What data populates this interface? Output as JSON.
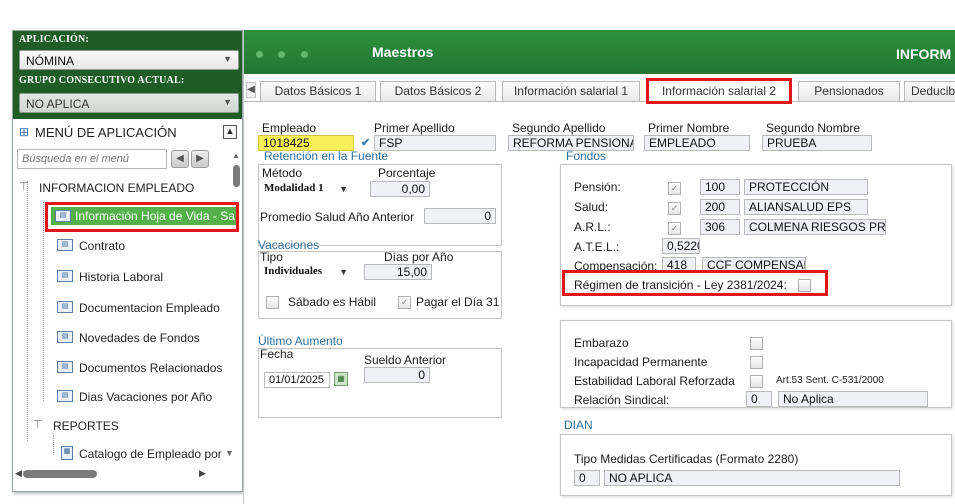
{
  "sidebar": {
    "app_label": "APLICACIÓN:",
    "app_value": "NÓMINA",
    "group_label": "GRUPO CONSECUTIVO ACTUAL:",
    "group_value": "NO APLICA",
    "menu_title": "MENÚ DE APLICACIÓN",
    "search_placeholder": "Búsqueda en el menú",
    "section": "INFORMACION EMPLEADO",
    "items": [
      {
        "label": "Información Hoja de Vida - Sa"
      },
      {
        "label": "Contrato"
      },
      {
        "label": "Historia Laboral"
      },
      {
        "label": "Documentacion Empleado"
      },
      {
        "label": "Novedades de Fondos"
      },
      {
        "label": "Documentos Relacionados"
      },
      {
        "label": "Dias Vacaciones por Año"
      }
    ],
    "reports": "REPORTES",
    "report_item": "Catalogo de Empleado por"
  },
  "header": {
    "title": "Maestros",
    "right_title": "INFORM"
  },
  "tabs": [
    {
      "label": "Datos Básicos 1"
    },
    {
      "label": "Datos Básicos 2"
    },
    {
      "label": "Información salarial 1"
    },
    {
      "label": "Información salarial 2"
    },
    {
      "label": "Pensionados"
    },
    {
      "label": "Deducib"
    }
  ],
  "employee": {
    "empleado_label": "Empleado",
    "empleado_value": "1018425",
    "primer_apellido_label": "Primer Apellido",
    "primer_apellido_value": "FSP",
    "segundo_apellido_label": "Segundo Apellido",
    "segundo_apellido_value": "REFORMA PENSIONAL",
    "primer_nombre_label": "Primer Nombre",
    "primer_nombre_value": "EMPLEADO",
    "segundo_nombre_label": "Segundo Nombre",
    "segundo_nombre_value": "PRUEBA"
  },
  "retencion": {
    "title": "Retención en la Fuente",
    "metodo_label": "Método",
    "metodo_value": "Modalidad 1",
    "porcentaje_label": "Porcentaje",
    "porcentaje_value": "0,00",
    "promedio_label": "Promedio Salud Año Anterior",
    "promedio_value": "0"
  },
  "vacaciones": {
    "title": "Vacaciones",
    "tipo_label": "Tipo",
    "tipo_value": "Individuales",
    "dias_label": "Días por Año",
    "dias_value": "15,00",
    "sabado_label": "Sábado es Hábil",
    "pagar_label": "Pagar el Día 31"
  },
  "aumento": {
    "title": "Último Aumento",
    "fecha_label": "Fecha",
    "fecha_value": "01/01/2025",
    "sueldo_label": "Sueldo Anterior",
    "sueldo_value": "0"
  },
  "fondos": {
    "title": "Fondos",
    "rows": [
      {
        "label": "Pensión:",
        "code": "100",
        "name": "PROTECCIÓN"
      },
      {
        "label": "Salud:",
        "code": "200",
        "name": "ALIANSALUD EPS"
      },
      {
        "label": "A.R.L.:",
        "code": "306",
        "name": "COLMENA RIESGOS PROFE"
      }
    ],
    "atel_label": "A.T.E.L.:",
    "atel_value": "0,5220",
    "compensacion_label": "Compensación:",
    "compensacion_code": "418",
    "compensacion_name": "CCF COMPENSAR",
    "regimen_label": "Régimen de transición - Ley 2381/2024:"
  },
  "otros": {
    "embarazo": "Embarazo",
    "incapacidad": "Incapacidad Permanente",
    "estabilidad": "Estabilidad Laboral Reforzada",
    "estabilidad_note": "Art.53 Sent. C-531/2000",
    "sindical_label": "Relación Sindical:",
    "sindical_code": "0",
    "sindical_value": "No Aplica"
  },
  "dian": {
    "title": "DIAN",
    "tipo_label": "Tipo Medidas Certificadas (Formato 2280)",
    "code": "0",
    "value": "NO APLICA"
  },
  "colors": {
    "brand_green": "#237733",
    "highlight_red": "#e0161b",
    "selected_green": "#55b04b"
  }
}
